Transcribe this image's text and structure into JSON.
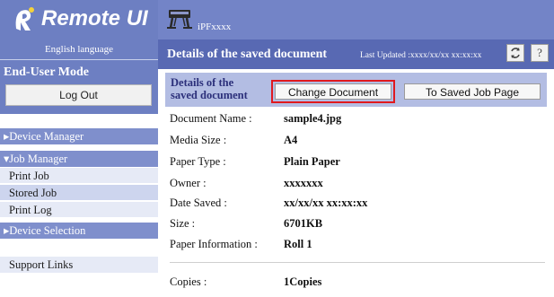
{
  "app": {
    "title": "Remote UI"
  },
  "sidebar": {
    "language": "English language",
    "mode_title": "End-User Mode",
    "logout_label": "Log Out",
    "device_manager": "Device Manager",
    "job_manager": "Job Manager",
    "job_items": [
      "Print Job",
      "Stored Job",
      "Print Log"
    ],
    "device_selection": "Device Selection",
    "support_links": "Support Links"
  },
  "header": {
    "printer_name": "iPFxxxx",
    "page_title": "Details of the saved document",
    "last_updated": "Last Updated :xxxx/xx/xx xx:xx:xx",
    "refresh_icon": "refresh-icon",
    "help_label": "?"
  },
  "details": {
    "label_line1": "Details of the",
    "label_line2": "saved document",
    "change_document": "Change Document",
    "to_saved_job": "To Saved Job Page"
  },
  "rows": [
    {
      "label": "Document Name :",
      "value": "sample4.jpg"
    },
    {
      "label": "Media Size :",
      "value": "A4"
    },
    {
      "label": "Paper Type :",
      "value": "Plain Paper"
    },
    {
      "label": "Owner :",
      "value": "xxxxxxx"
    },
    {
      "label": "Date Saved :",
      "value": "xx/xx/xx xx:xx:xx"
    },
    {
      "label": "Size :",
      "value": "6701KB"
    },
    {
      "label": "Paper Information :",
      "value": "Roll 1"
    },
    {
      "label": "Copies :",
      "value": "1Copies"
    }
  ],
  "colors": {
    "accent": "#5869b3",
    "highlight": "#e0191f"
  }
}
